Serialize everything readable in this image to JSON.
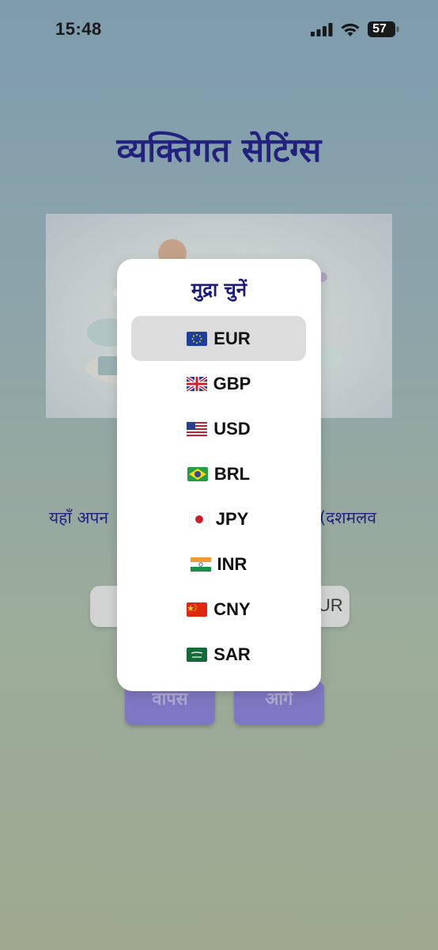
{
  "status_bar": {
    "time": "15:48",
    "battery": "57"
  },
  "page": {
    "title": "व्यक्तिगत सेटिंग्स",
    "instruction_left": "यहाँ अपन",
    "instruction_right": "(दशमलव",
    "amount_placeholder": "",
    "currency_suffix": "UR",
    "back_label": "वापस",
    "next_label": "आगे"
  },
  "picker": {
    "title": "मुद्रा चुनें",
    "selected": "EUR",
    "options": [
      {
        "code": "EUR",
        "flag": "eu-flag-icon"
      },
      {
        "code": "GBP",
        "flag": "uk-flag-icon"
      },
      {
        "code": "USD",
        "flag": "us-flag-icon"
      },
      {
        "code": "BRL",
        "flag": "brazil-flag-icon"
      },
      {
        "code": "JPY",
        "flag": "japan-flag-icon"
      },
      {
        "code": "INR",
        "flag": "india-flag-icon"
      },
      {
        "code": "CNY",
        "flag": "china-flag-icon"
      },
      {
        "code": "SAR",
        "flag": "saudi-flag-icon"
      }
    ]
  },
  "colors": {
    "title": "#1c1a7d",
    "button": "#7f77c9",
    "selected_row": "#dcdcdc"
  }
}
